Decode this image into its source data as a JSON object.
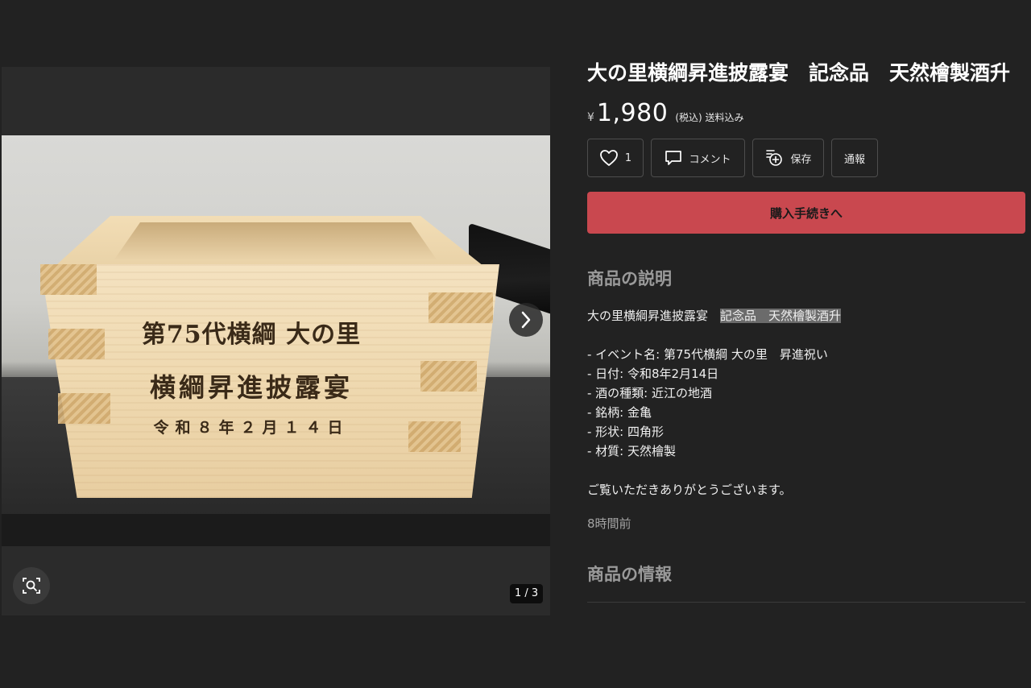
{
  "gallery": {
    "engraving": {
      "line1": "第75代横綱 大の里",
      "line2": "横綱昇進披露宴",
      "line3": "令和８年２月１４日"
    },
    "counter": "1 / 3",
    "icons": {
      "next": "chevron-right-icon",
      "zoom": "image-search-icon"
    }
  },
  "product": {
    "title": "大の里横綱昇進披露宴　記念品　天然檜製酒升",
    "currency_symbol": "¥",
    "price": "1,980",
    "tax_note": "(税込) 送料込み"
  },
  "actions": {
    "like_count": "1",
    "comment_label": "コメント",
    "save_label": "保存",
    "report_label": "通報"
  },
  "buy_button_label": "購入手続きへ",
  "description": {
    "heading": "商品の説明",
    "line1_plain": "大の里横綱昇進披露宴　",
    "line1_highlight": "記念品　天然檜製酒升",
    "items": [
      "- イベント名: 第75代横綱 大の里　昇進祝い",
      "- 日付: 令和8年2月14日",
      "- 酒の種類: 近江の地酒",
      "- 銘柄: 金亀",
      "- 形状: 四角形",
      "- 材質: 天然檜製"
    ],
    "closing": "ご覧いただきありがとうございます。",
    "posted_ago": "8時間前"
  },
  "info_heading": "商品の情報",
  "colors": {
    "background": "#222222",
    "buy_button": "#c9484f",
    "heading_gray": "#9a9a9a",
    "highlight": "#6b6b6b"
  }
}
